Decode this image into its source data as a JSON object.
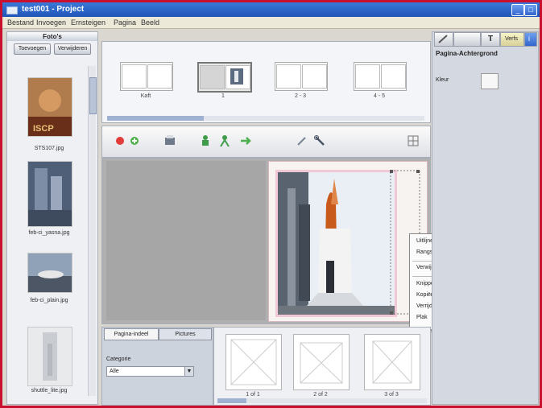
{
  "window": {
    "title": "test001 - Project",
    "app_icon": "app-icon"
  },
  "menu": [
    "Bestand",
    "Invoegen",
    "Ernsteigen",
    "Pagina",
    "Beeld"
  ],
  "left_panel": {
    "header": "Foto's",
    "buttons": [
      "Toevoegen",
      "Verwijderen"
    ],
    "photos": [
      {
        "name": "STS107.jpg",
        "color": "#8a4a2a"
      },
      {
        "name": "feb-ci_yasna.jpg",
        "color": "#5f7089"
      },
      {
        "name": "feb-ci_plain.jpg",
        "color": "#6d7a88"
      },
      {
        "name": "shuttle_lite.jpg",
        "color": "#c9ccd0"
      }
    ]
  },
  "pages": [
    {
      "label": "Kaft",
      "selected": false
    },
    {
      "label": "1",
      "selected": true
    },
    {
      "label": "2 - 3",
      "selected": false
    },
    {
      "label": "4 - 5",
      "selected": false
    }
  ],
  "toolbar": {
    "icons": [
      "delete-icon",
      "add-icon",
      "print-icon",
      "person-add-icon",
      "person-move-icon",
      "arrow-right-icon",
      "wand-icon",
      "wrench-icon",
      "grid-icon"
    ]
  },
  "context_menu": {
    "items": [
      {
        "label": "Uitlijnen",
        "submenu": true
      },
      {
        "label": "Rangschikken",
        "submenu": true
      },
      {
        "label": "Verwijderen",
        "submenu": false
      },
      {
        "label": "Knippen",
        "submenu": false
      },
      {
        "label": "Kopiëren",
        "submenu": false
      },
      {
        "label": "Verrijdigen",
        "submenu": false
      },
      {
        "label": "Plak",
        "submenu": false
      }
    ]
  },
  "bottom_tabs": {
    "tabs": [
      "Pagina-indeel",
      "Pictures"
    ],
    "category_label": "Categorie",
    "category_value": "Alle"
  },
  "layouts": [
    "1 of 1",
    "2 of 2",
    "3 of 3"
  ],
  "right_panel": {
    "tab_label": "Verfs",
    "title": "Pagina-Achtergrond",
    "field_label": "Kleur",
    "swatch_color": "#f7f7f7"
  },
  "colors": {
    "titlebar": "#2a63c6",
    "window_border": "#c8102e"
  }
}
